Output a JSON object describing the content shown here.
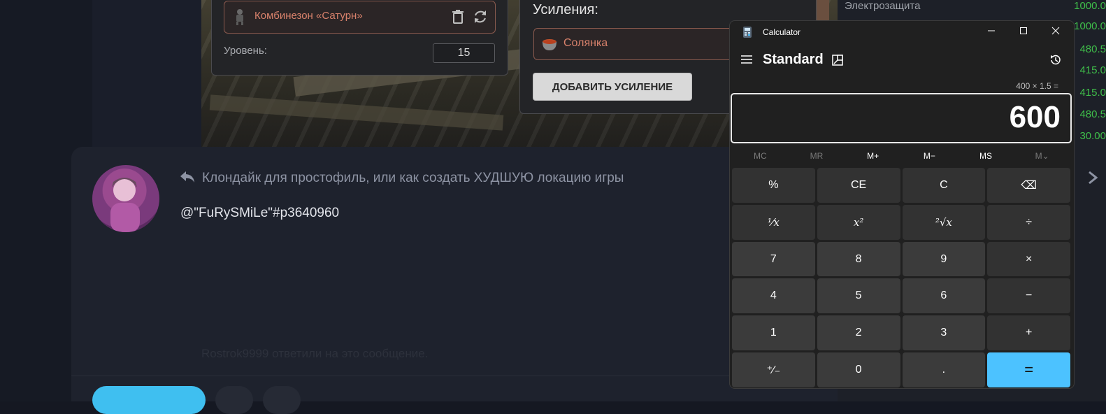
{
  "game": {
    "suit_name": "Комбинезон «Сатурн»",
    "level_label": "Уровень:",
    "level_value": "15",
    "boosts_title": "Усиления:",
    "boost_item": "Солянка",
    "add_boost_label": "ДОБАВИТЬ УСИЛЕНИЕ"
  },
  "stats": [
    {
      "name": "Электрозащита",
      "value": "1000.0"
    },
    {
      "name": "",
      "value": "1000.0"
    },
    {
      "name": "",
      "value": "480.5"
    },
    {
      "name": "",
      "value": "415.0"
    },
    {
      "name": "",
      "value": "415.0"
    },
    {
      "name": "",
      "value": "480.5"
    },
    {
      "name": "",
      "value": "30.00"
    }
  ],
  "post": {
    "reply_title": "Клондайк для простофиль, или как создать ХУДШУЮ локацию игры",
    "mention": "@\"FuRySMiLe\"#p3640960",
    "replies_note": "Rostrok9999 ответили на это сообщение."
  },
  "calculator": {
    "app_title": "Calculator",
    "mode": "Standard",
    "expression": "400 × 1.5 =",
    "display": "600",
    "memory": [
      {
        "label": "MC",
        "enabled": false
      },
      {
        "label": "MR",
        "enabled": false
      },
      {
        "label": "M+",
        "enabled": true
      },
      {
        "label": "M−",
        "enabled": true
      },
      {
        "label": "MS",
        "enabled": true
      },
      {
        "label": "M⌄",
        "enabled": false
      }
    ],
    "keys": {
      "percent": "%",
      "ce": "CE",
      "c": "C",
      "backspace": "⌫",
      "reciprocal": "¹⁄x",
      "square": "x²",
      "sqrt": "²√x",
      "divide": "÷",
      "seven": "7",
      "eight": "8",
      "nine": "9",
      "multiply": "×",
      "four": "4",
      "five": "5",
      "six": "6",
      "minus": "−",
      "one": "1",
      "two": "2",
      "three": "3",
      "plus": "+",
      "negate": "⁺∕₋",
      "zero": "0",
      "decimal": ".",
      "equals": "="
    },
    "accent_color": "#4cc2ff"
  }
}
